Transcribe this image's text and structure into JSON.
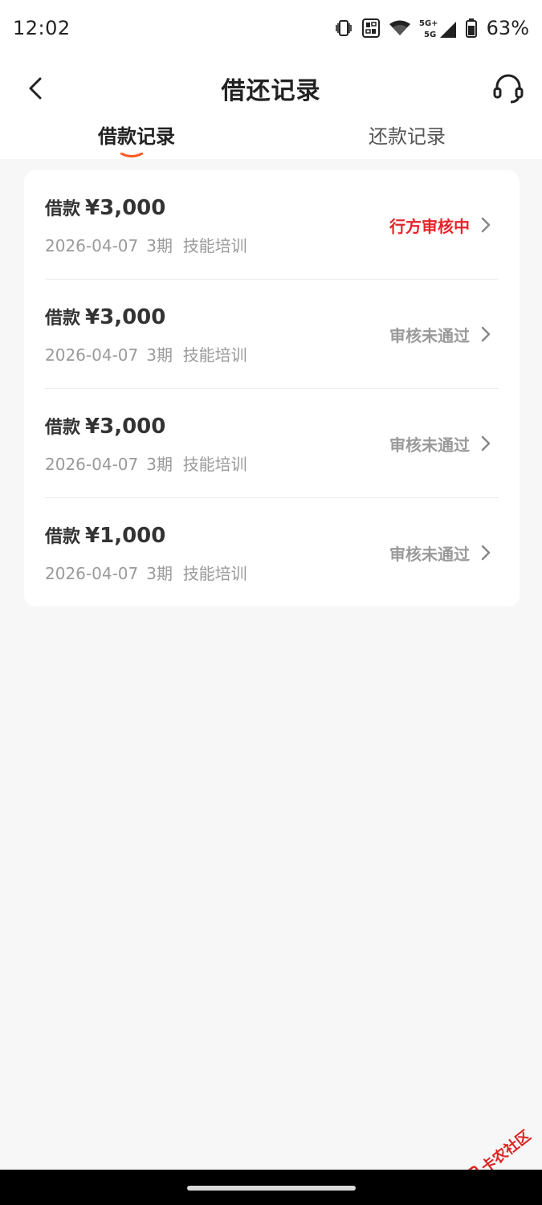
{
  "status_bar": {
    "time": "12:02",
    "battery": "63%",
    "icons": [
      "vibrate-icon",
      "nfc-icon",
      "wifi-icon",
      "signal-icon",
      "battery-icon"
    ],
    "network_top": "5G+",
    "network_bottom": "5G"
  },
  "header": {
    "title": "借还记录",
    "back_icon": "chevron-left-icon",
    "service_icon": "headset-icon"
  },
  "tabs": [
    {
      "label": "借款记录",
      "active": true
    },
    {
      "label": "还款记录",
      "active": false
    }
  ],
  "records": [
    {
      "prefix": "借款",
      "amount": "¥3,000",
      "date": "2026-04-07",
      "term": "3期",
      "purpose": "技能培训",
      "status": "行方审核中"
    },
    {
      "prefix": "借款",
      "amount": "¥3,000",
      "date": "2026-04-07",
      "term": "3期",
      "purpose": "技能培训",
      "status": "审核未通过"
    },
    {
      "prefix": "借款",
      "amount": "¥3,000",
      "date": "2026-04-07",
      "term": "3期",
      "purpose": "技能培训",
      "status": "审核未通过"
    },
    {
      "prefix": "借款",
      "amount": "¥1,000",
      "date": "2026-04-07",
      "term": "3期",
      "purpose": "技能培训",
      "status": "审核未通过"
    }
  ],
  "watermark": {
    "text": "卡农社区"
  },
  "colors": {
    "accent": "#ff5a1f",
    "status_active": "#e8242a",
    "status_muted": "#9a9a9a",
    "background": "#f7f7f7"
  }
}
